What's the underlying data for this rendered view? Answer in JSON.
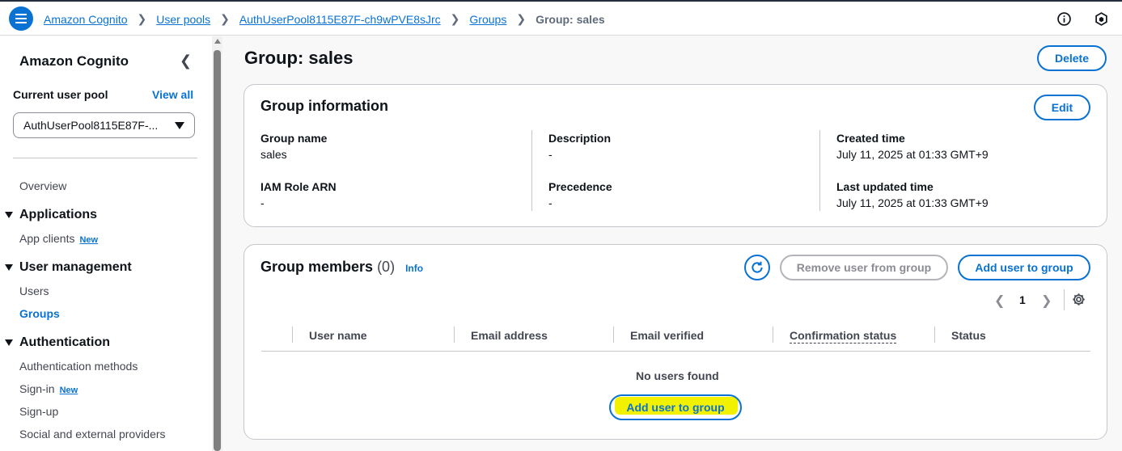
{
  "breadcrumb": {
    "items": [
      "Amazon Cognito",
      "User pools",
      "AuthUserPool8115E87F-ch9wPVE8sJrc",
      "Groups"
    ],
    "current": "Group: sales"
  },
  "sidebar": {
    "title": "Amazon Cognito",
    "pool_label": "Current user pool",
    "view_all": "View all",
    "pool_selected": "AuthUserPool8115E87F-...",
    "overview": "Overview",
    "sections": [
      {
        "label": "Applications",
        "items": [
          {
            "label": "App clients",
            "badge": "New"
          }
        ]
      },
      {
        "label": "User management",
        "items": [
          {
            "label": "Users"
          },
          {
            "label": "Groups",
            "active": true
          }
        ]
      },
      {
        "label": "Authentication",
        "items": [
          {
            "label": "Authentication methods"
          },
          {
            "label": "Sign-in",
            "badge": "New"
          },
          {
            "label": "Sign-up"
          },
          {
            "label": "Social and external providers"
          }
        ]
      }
    ]
  },
  "page": {
    "title": "Group: sales",
    "delete_label": "Delete"
  },
  "group_info": {
    "title": "Group information",
    "edit_label": "Edit",
    "group_name_label": "Group name",
    "group_name": "sales",
    "description_label": "Description",
    "description": "-",
    "created_label": "Created time",
    "created": "July 11, 2025 at 01:33 GMT+9",
    "iam_label": "IAM Role ARN",
    "iam": "-",
    "precedence_label": "Precedence",
    "precedence": "-",
    "updated_label": "Last updated time",
    "updated": "July 11, 2025 at 01:33 GMT+9"
  },
  "members": {
    "title": "Group members",
    "count": "(0)",
    "info": "Info",
    "remove_label": "Remove user from group",
    "add_label": "Add user to group",
    "page": "1",
    "columns": [
      "User name",
      "Email address",
      "Email verified",
      "Confirmation status",
      "Status"
    ],
    "empty_text": "No users found",
    "empty_add_label": "Add user to group"
  },
  "colors": {
    "accent": "#0972d3",
    "highlight": "#f2f200"
  }
}
